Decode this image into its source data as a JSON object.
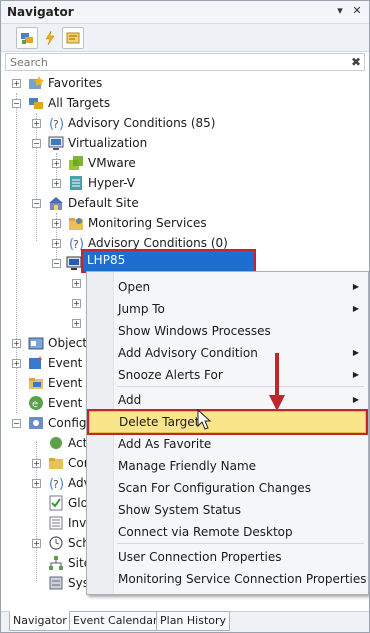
{
  "panel": {
    "title": "Navigator",
    "pin_glyph": "▾",
    "close_glyph": "✕",
    "search_placeholder": "Search",
    "search_clear": "✖"
  },
  "toolbar": {
    "buttons": [
      {
        "name": "targets-view-icon"
      },
      {
        "name": "alerts-lightning-icon"
      },
      {
        "name": "notes-icon"
      }
    ]
  },
  "tree": {
    "favorites": "Favorites",
    "all_targets": "All Targets",
    "advisory_conditions_top": "Advisory Conditions (85)",
    "virtualization": "Virtualization",
    "vmware": "VMware",
    "hyperv": "Hyper-V",
    "default_site": "Default Site",
    "monitoring_services": "Monitoring Services",
    "advisory_conditions_site": "Advisory Conditions (0)",
    "selected_target": "LHP85",
    "object": "Object",
    "event_c1": "Event C",
    "event_c2": "Event C",
    "event_a": "Event a",
    "config": "Config",
    "acti": "Acti",
    "con": "Con",
    "adv": "Adv",
    "glo": "Glo",
    "inve": "Inve",
    "sch": "Sch",
    "site": "Site",
    "sys": "Sys"
  },
  "context_menu": {
    "items": [
      {
        "label": "Open",
        "submenu": true
      },
      {
        "label": "Jump To",
        "submenu": true
      },
      {
        "label": "Show Windows Processes",
        "submenu": false
      },
      {
        "label": "Add Advisory Condition",
        "submenu": true
      },
      {
        "label": "Snooze Alerts For",
        "submenu": true
      },
      {
        "label": "Add",
        "submenu": true
      },
      {
        "label": "Delete Target",
        "submenu": false
      },
      {
        "label": "Add As Favorite",
        "submenu": false
      },
      {
        "label": "Manage Friendly Name",
        "submenu": false
      },
      {
        "label": "Scan For Configuration Changes",
        "submenu": false
      },
      {
        "label": "Show System Status",
        "submenu": false
      },
      {
        "label": "Connect via Remote Desktop",
        "submenu": false
      },
      {
        "label": "User Connection Properties",
        "submenu": false
      },
      {
        "label": "Monitoring Service Connection Properties",
        "submenu": false
      }
    ],
    "submenu_glyph": "▶",
    "highlighted_item": "Delete Target"
  },
  "tabs": [
    "Navigator",
    "Event Calendar",
    "Plan History"
  ],
  "colors": {
    "selection": "#1c6fd1",
    "highlight": "#fbe58a",
    "annotation_red": "#c0262d"
  }
}
